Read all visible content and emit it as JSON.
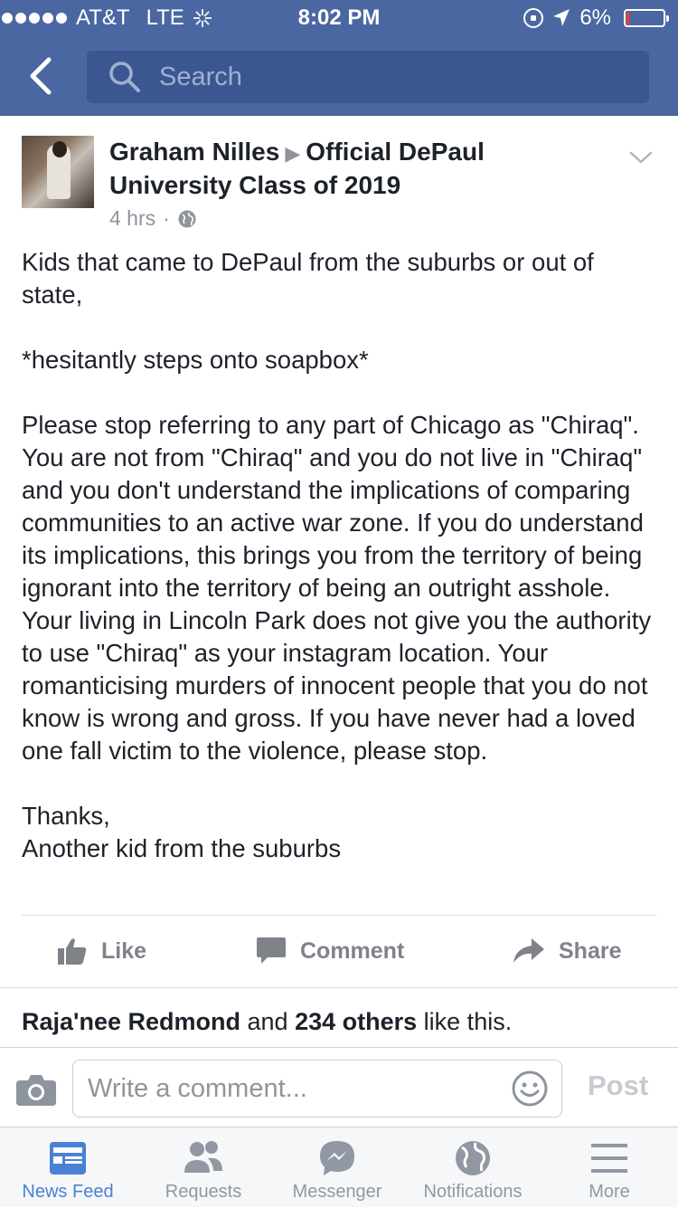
{
  "status_bar": {
    "carrier": "AT&T",
    "network": "LTE",
    "time": "8:02 PM",
    "battery": "6%"
  },
  "header": {
    "search_placeholder": "Search"
  },
  "post": {
    "author": "Graham Nilles",
    "group": "Official DePaul University Class of 2019",
    "time_ago": "4 hrs",
    "privacy_icon": "globe-icon",
    "body": [
      "Kids that came to DePaul from the suburbs or out of state,",
      "*hesitantly steps onto soapbox*",
      "Please stop referring to any part of Chicago as \"Chiraq\". You are not from \"Chiraq\" and you do not live in \"Chiraq\" and you don't understand the implications of comparing communities to an active war zone. If you do understand its implications, this brings you from the territory of being ignorant into the territory of being an outright asshole. Your living in Lincoln Park does not give you the authority to use \"Chiraq\" as your instagram location. Your romanticising murders of innocent people that you do not know is wrong and gross. If you have never had a loved one fall victim to the violence, please stop.",
      "Thanks,\nAnother kid from the suburbs"
    ],
    "actions": {
      "like": "Like",
      "comment": "Comment",
      "share": "Share"
    },
    "likes_summary": {
      "first_name": "Raja'nee Redmond",
      "and": "and",
      "others": "234 others",
      "suffix": "like this."
    }
  },
  "composer": {
    "placeholder": "Write a comment...",
    "post_label": "Post"
  },
  "tabs": [
    {
      "label": "News Feed",
      "icon": "news-feed-icon",
      "active": true
    },
    {
      "label": "Requests",
      "icon": "requests-icon",
      "active": false
    },
    {
      "label": "Messenger",
      "icon": "messenger-icon",
      "active": false
    },
    {
      "label": "Notifications",
      "icon": "globe-icon",
      "active": false
    },
    {
      "label": "More",
      "icon": "menu-icon",
      "active": false
    }
  ],
  "colors": {
    "header_blue": "#4b67a1",
    "active_tab": "#4a80d6",
    "muted": "#90949c"
  }
}
